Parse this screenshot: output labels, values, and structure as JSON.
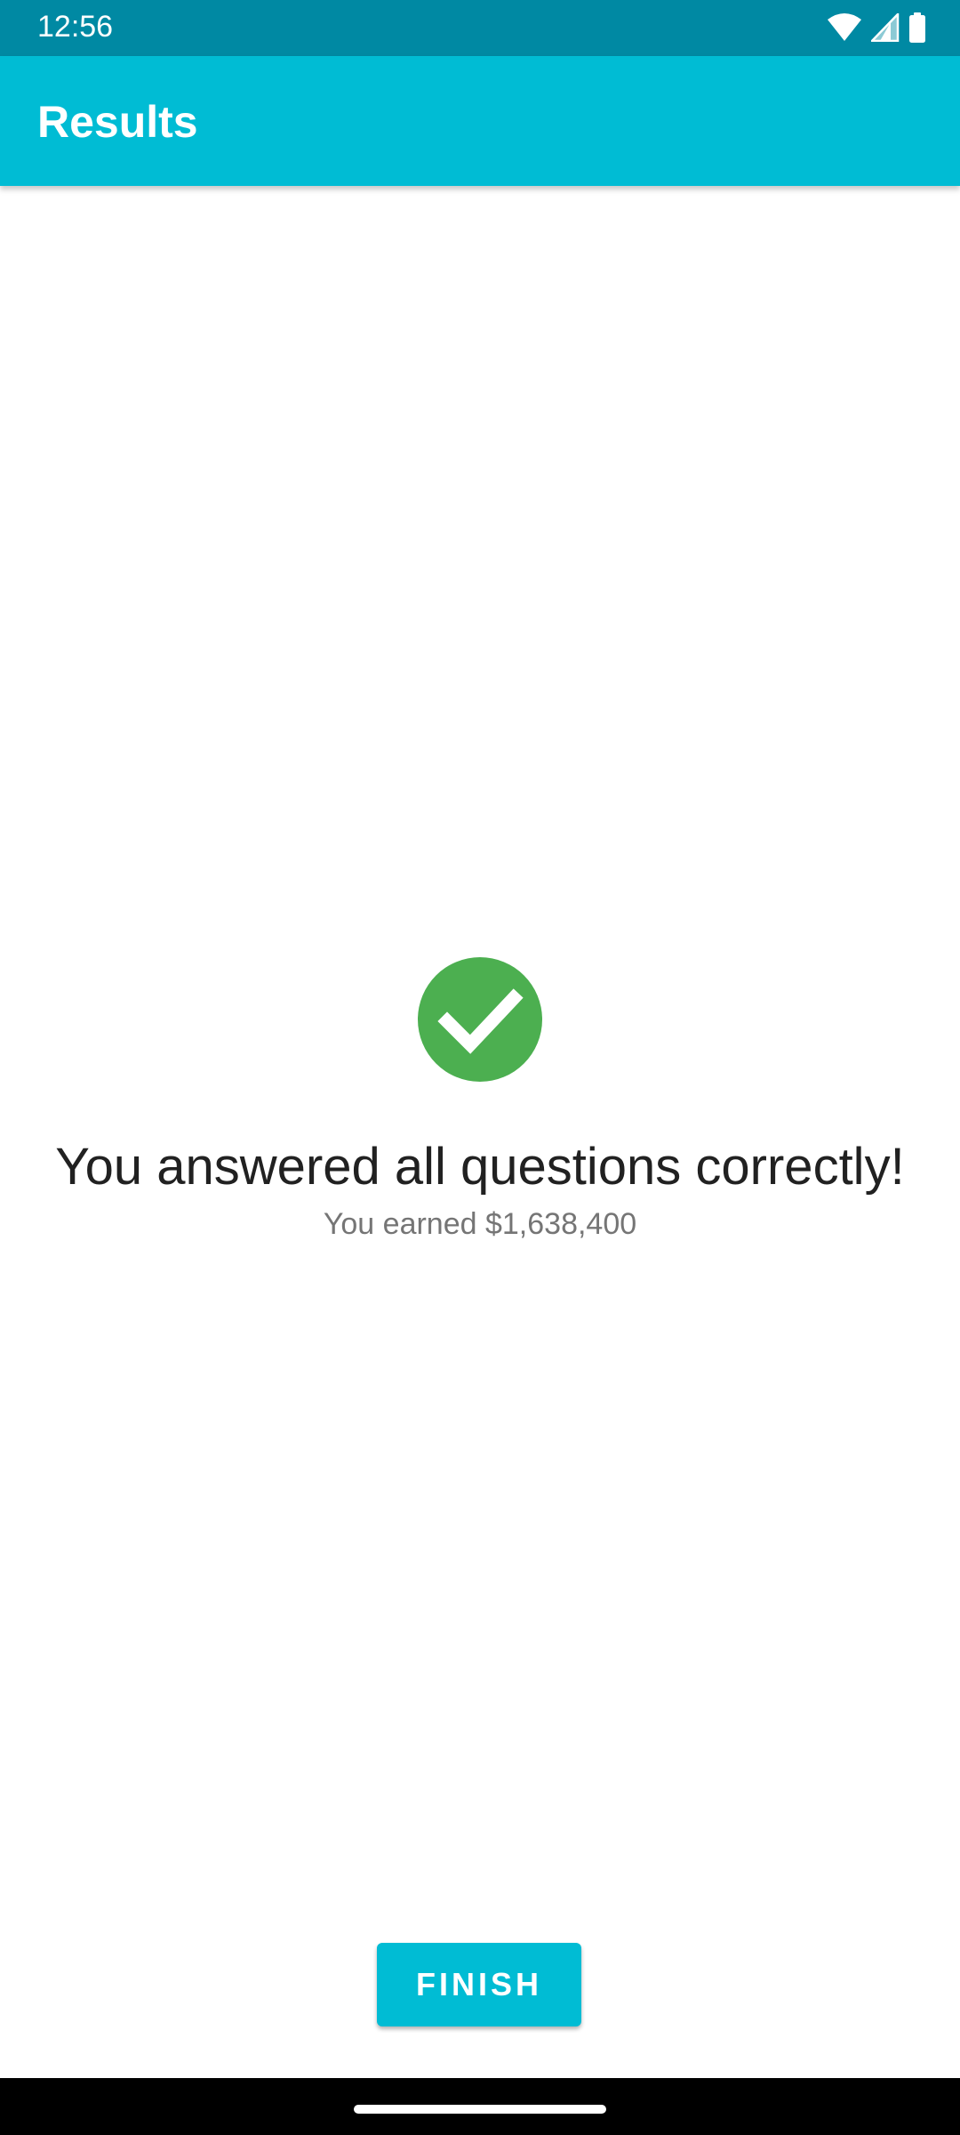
{
  "status_bar": {
    "time": "12:56",
    "icons": [
      "wifi-icon",
      "cell-signal-icon",
      "battery-icon"
    ]
  },
  "app_bar": {
    "title": "Results"
  },
  "result": {
    "icon": "check-circle-icon",
    "title": "You answered all questions correctly!",
    "subtitle": "You earned $1,638,400"
  },
  "actions": {
    "finish_label": "FINISH"
  },
  "colors": {
    "status_bar": "#0089a3",
    "primary": "#00bcd4",
    "success": "#4caf50",
    "title_text": "#212121",
    "subtitle_text": "#757575"
  }
}
